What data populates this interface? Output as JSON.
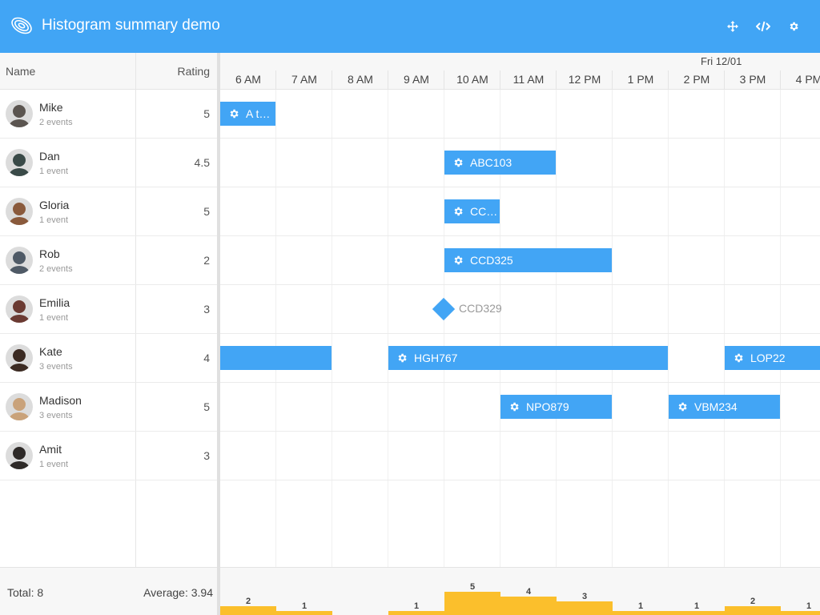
{
  "app": {
    "title": "Histogram summary demo"
  },
  "toolbar": {
    "buttons": [
      {
        "icon": "move-icon"
      },
      {
        "icon": "code-icon"
      },
      {
        "icon": "gear-icon"
      }
    ]
  },
  "grid": {
    "columns": {
      "name": "Name",
      "rating": "Rating"
    },
    "rows": [
      {
        "name": "Mike",
        "events": "2 events",
        "rating": "5",
        "avatar_color": "#5b5550"
      },
      {
        "name": "Dan",
        "events": "1 event",
        "rating": "4.5",
        "avatar_color": "#3a4a48"
      },
      {
        "name": "Gloria",
        "events": "1 event",
        "rating": "5",
        "avatar_color": "#8a5a3c"
      },
      {
        "name": "Rob",
        "events": "2 events",
        "rating": "2",
        "avatar_color": "#4f5a66"
      },
      {
        "name": "Emilia",
        "events": "1 event",
        "rating": "3",
        "avatar_color": "#6b3a32"
      },
      {
        "name": "Kate",
        "events": "3 events",
        "rating": "4",
        "avatar_color": "#3b2a22"
      },
      {
        "name": "Madison",
        "events": "3 events",
        "rating": "5",
        "avatar_color": "#c9a27a"
      },
      {
        "name": "Amit",
        "events": "1 event",
        "rating": "3",
        "avatar_color": "#2e2a28"
      }
    ]
  },
  "timeline": {
    "date": "Fri 12/01",
    "hours": [
      "6 AM",
      "7 AM",
      "8 AM",
      "9 AM",
      "10 AM",
      "11 AM",
      "12 PM",
      "1 PM",
      "2 PM",
      "3 PM",
      "4 PM"
    ],
    "events": [
      {
        "row": 0,
        "start": 0,
        "end": 1,
        "label": "A t…",
        "icon": "gear-icon"
      },
      {
        "row": 1,
        "start": 4,
        "end": 6,
        "label": "ABC103",
        "icon": "gear-icon"
      },
      {
        "row": 2,
        "start": 4,
        "end": 5,
        "label": "CC…",
        "icon": "gear-icon"
      },
      {
        "row": 3,
        "start": 4,
        "end": 7,
        "label": "CCD325",
        "icon": "gear-icon"
      },
      {
        "row": 5,
        "start": -1,
        "end": 2,
        "label": "",
        "icon": ""
      },
      {
        "row": 5,
        "start": 3,
        "end": 8,
        "label": "HGH767",
        "icon": "gear-icon"
      },
      {
        "row": 5,
        "start": 9,
        "end": 11,
        "label": "LOP22",
        "icon": "gear-icon"
      },
      {
        "row": 6,
        "start": 5,
        "end": 7,
        "label": "NPO879",
        "icon": "gear-icon"
      },
      {
        "row": 6,
        "start": 8,
        "end": 10,
        "label": "VBM234",
        "icon": "gear-icon"
      }
    ],
    "milestones": [
      {
        "row": 4,
        "at": 4,
        "label": "CCD329"
      }
    ]
  },
  "summary": {
    "total": "Total: 8",
    "average": "Average: 3.94",
    "histogram": {
      "color": "#fbbf2c",
      "max": 5,
      "counts": [
        2,
        1,
        0,
        1,
        5,
        4,
        3,
        1,
        1,
        2,
        1
      ],
      "labels": [
        "2",
        "1",
        "",
        "1",
        "5",
        "4",
        "3",
        "1",
        "1",
        "2",
        "1"
      ]
    }
  }
}
